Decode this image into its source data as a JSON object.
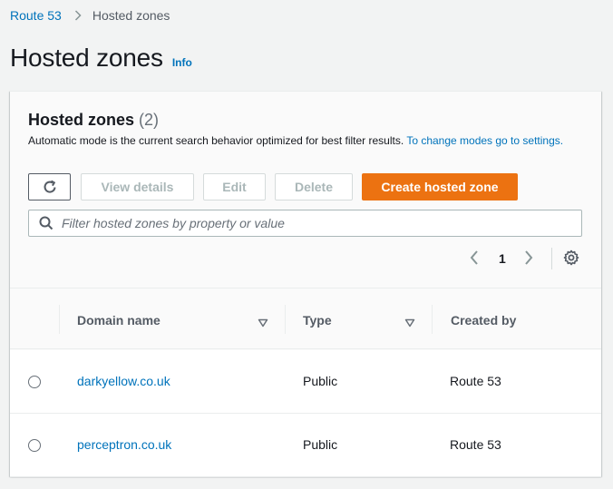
{
  "breadcrumb": {
    "items": [
      "Route 53",
      "Hosted zones"
    ]
  },
  "page": {
    "title": "Hosted zones",
    "info_label": "Info"
  },
  "container": {
    "title": "Hosted zones",
    "count": "(2)",
    "description": "Automatic mode is the current search behavior optimized for best filter results.",
    "description_link": "To change modes go to settings."
  },
  "toolbar": {
    "view_details_label": "View details",
    "edit_label": "Edit",
    "delete_label": "Delete",
    "create_label": "Create hosted zone"
  },
  "search": {
    "placeholder": "Filter hosted zones by property or value"
  },
  "pagination": {
    "current_page": "1"
  },
  "table": {
    "columns": [
      "Domain name",
      "Type",
      "Created by"
    ],
    "rows": [
      {
        "domain": "darkyellow.co.uk",
        "type": "Public",
        "created_by": "Route 53"
      },
      {
        "domain": "perceptron.co.uk",
        "type": "Public",
        "created_by": "Route 53"
      }
    ]
  },
  "colors": {
    "link": "#0073bb",
    "primary_button": "#ec7211",
    "text": "#16191f",
    "disabled": "#aab7b8"
  }
}
